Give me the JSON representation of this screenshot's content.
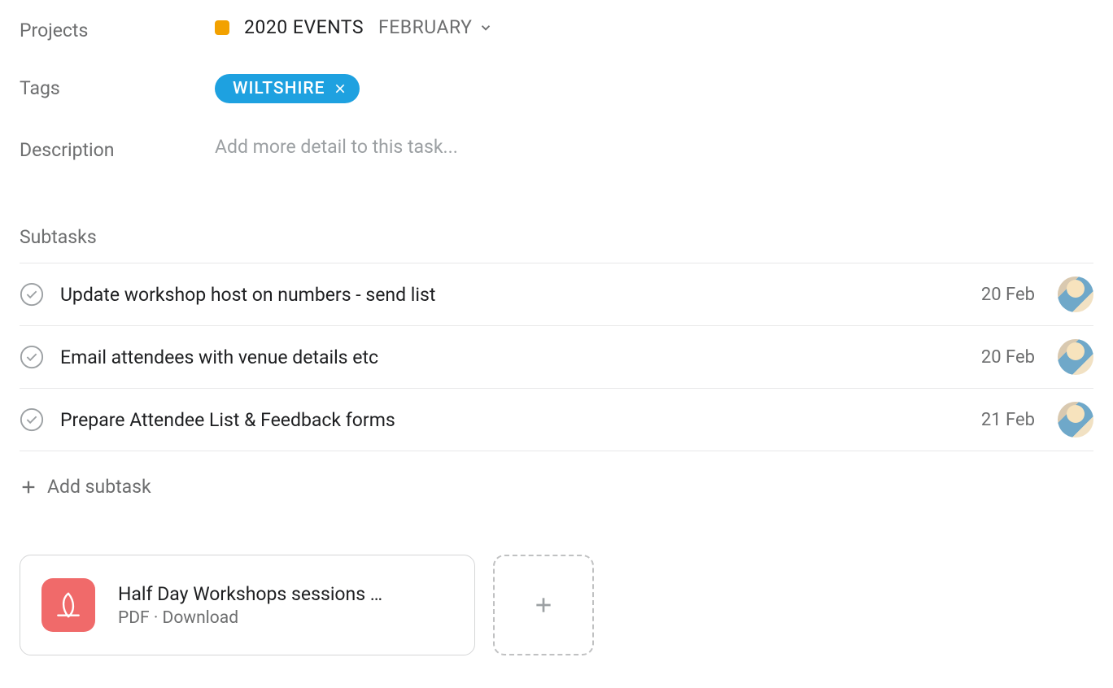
{
  "fields": {
    "projectsLabel": "Projects",
    "tagsLabel": "Tags",
    "descriptionLabel": "Description"
  },
  "project": {
    "name": "2020 EVENTS",
    "section": "FEBRUARY",
    "color": "#f2a100"
  },
  "tags": [
    {
      "label": "WILTSHIRE"
    }
  ],
  "description": {
    "placeholder": "Add more detail to this task..."
  },
  "subtasks": {
    "header": "Subtasks",
    "addLabel": "Add subtask",
    "items": [
      {
        "name": "Update workshop host on numbers - send list",
        "date": "20 Feb"
      },
      {
        "name": "Email attendees with venue details etc",
        "date": "20 Feb"
      },
      {
        "name": "Prepare Attendee List & Feedback forms",
        "date": "21 Feb"
      }
    ]
  },
  "attachments": [
    {
      "name": "Half Day Workshops sessions …",
      "type": "PDF",
      "action": "Download"
    }
  ]
}
